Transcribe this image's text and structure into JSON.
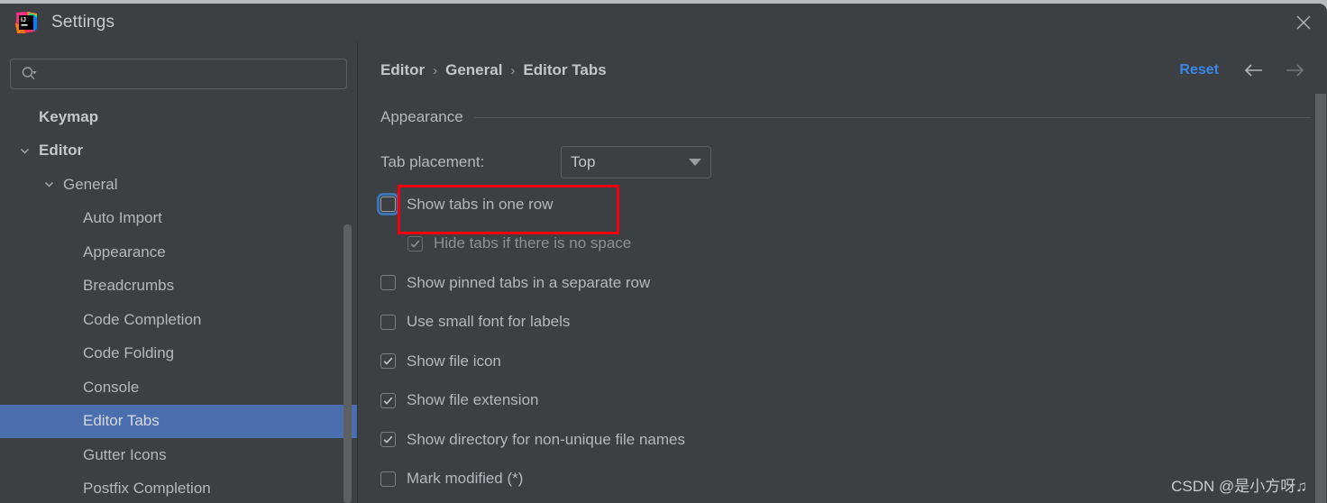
{
  "window": {
    "title": "Settings",
    "logo_icon": "intellij-idea-logo",
    "close_icon": "close-icon"
  },
  "sidebar": {
    "search": {
      "value": "",
      "placeholder": "",
      "icon": "search-icon"
    },
    "items": [
      {
        "label": "Keymap",
        "indent": 43,
        "bold": true,
        "twisty": "none",
        "selected": false
      },
      {
        "label": "Editor",
        "indent": 43,
        "bold": true,
        "twisty": "chevron-down",
        "selected": false
      },
      {
        "label": "General",
        "indent": 70,
        "bold": false,
        "twisty": "chevron-down",
        "selected": false
      },
      {
        "label": "Auto Import",
        "indent": 92,
        "bold": false,
        "twisty": "none",
        "selected": false
      },
      {
        "label": "Appearance",
        "indent": 92,
        "bold": false,
        "twisty": "none",
        "selected": false
      },
      {
        "label": "Breadcrumbs",
        "indent": 92,
        "bold": false,
        "twisty": "none",
        "selected": false
      },
      {
        "label": "Code Completion",
        "indent": 92,
        "bold": false,
        "twisty": "none",
        "selected": false
      },
      {
        "label": "Code Folding",
        "indent": 92,
        "bold": false,
        "twisty": "none",
        "selected": false
      },
      {
        "label": "Console",
        "indent": 92,
        "bold": false,
        "twisty": "none",
        "selected": false
      },
      {
        "label": "Editor Tabs",
        "indent": 92,
        "bold": false,
        "twisty": "none",
        "selected": true
      },
      {
        "label": "Gutter Icons",
        "indent": 92,
        "bold": false,
        "twisty": "none",
        "selected": false
      },
      {
        "label": "Postfix Completion",
        "indent": 92,
        "bold": false,
        "twisty": "none",
        "selected": false
      }
    ]
  },
  "content": {
    "breadcrumb": [
      "Editor",
      "General",
      "Editor Tabs"
    ],
    "breadcrumb_separator": "›",
    "reset_label": "Reset",
    "back_icon": "arrow-left-icon",
    "forward_icon": "arrow-right-icon",
    "section_title": "Appearance",
    "tab_placement": {
      "label": "Tab placement:",
      "value": "Top",
      "arrow_icon": "chevron-down-icon"
    },
    "checkboxes": [
      {
        "label": "Show tabs in one row",
        "checked": false,
        "enabled": true,
        "focused": true,
        "indent": false
      },
      {
        "label": "Hide tabs if there is no space",
        "checked": true,
        "enabled": false,
        "focused": false,
        "indent": true
      },
      {
        "label": "Show pinned tabs in a separate row",
        "checked": false,
        "enabled": true,
        "focused": false,
        "indent": false
      },
      {
        "label": "Use small font for labels",
        "checked": false,
        "enabled": true,
        "focused": false,
        "indent": false
      },
      {
        "label": "Show file icon",
        "checked": true,
        "enabled": true,
        "focused": false,
        "indent": false
      },
      {
        "label": "Show file extension",
        "checked": true,
        "enabled": true,
        "focused": false,
        "indent": false
      },
      {
        "label": "Show directory for non-unique file names",
        "checked": true,
        "enabled": true,
        "focused": false,
        "indent": false
      },
      {
        "label": "Mark modified (*)",
        "checked": false,
        "enabled": true,
        "focused": false,
        "indent": false
      }
    ]
  },
  "annotation": {
    "color": "#f3000f",
    "target": "Show tabs in one row"
  },
  "watermark": "CSDN @是小方呀♫",
  "colors": {
    "window_bg": "#3c4043",
    "selection_blue": "#4b6eaf",
    "link_blue": "#3b87e8",
    "text": "#b5b8bb",
    "annotation_red": "#f3000f"
  }
}
